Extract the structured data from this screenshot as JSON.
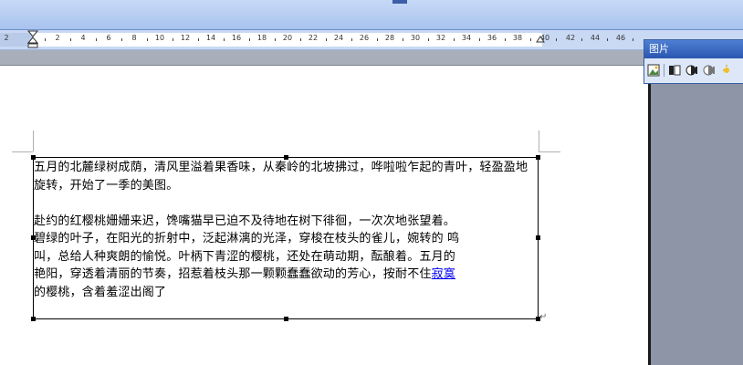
{
  "ruler": {
    "labels": [
      "2",
      "2",
      "4",
      "6",
      "8",
      "10",
      "12",
      "14",
      "16",
      "18",
      "20",
      "22",
      "24",
      "26",
      "28",
      "30",
      "32",
      "34",
      "36",
      "38",
      "40",
      "42",
      "44",
      "46"
    ]
  },
  "picture_toolbar": {
    "title": "图片",
    "icons": [
      "insert-picture-icon",
      "color-icon",
      "more-contrast-icon",
      "less-contrast-icon",
      "more-brightness-icon"
    ]
  },
  "textbox": {
    "paragraph1": "五月的北麓绿树成荫，清风里溢着果香味，从秦岭的北坡拂过，哗啦啦乍起的青叶，轻盈盈地旋转，开始了一季的美图。",
    "paragraph2_line1": "赴约的红樱桃姗姗来迟，馋嘴猫早已迫不及待地在树下徘徊，一次次地张望着。",
    "paragraph2_line2": "碧绿的叶子，在阳光的折射中，泛起淋漓的光泽，穿梭在枝头的雀儿，婉转的 鸣",
    "paragraph2_line3": "叫，总给人种爽朗的愉悦。叶柄下青涩的樱桃，还处在萌动期，酝酿着。五月的",
    "paragraph2_line4_pre": "艳阳，穿透着清丽的节奏，招惹着枝头那一颗颗蠢蠢欲动的芳心，按耐不住",
    "paragraph2_link": "寂寞",
    "paragraph2_line5": "的樱桃，含着羞涩出阁了",
    "end_mark": "↵"
  }
}
